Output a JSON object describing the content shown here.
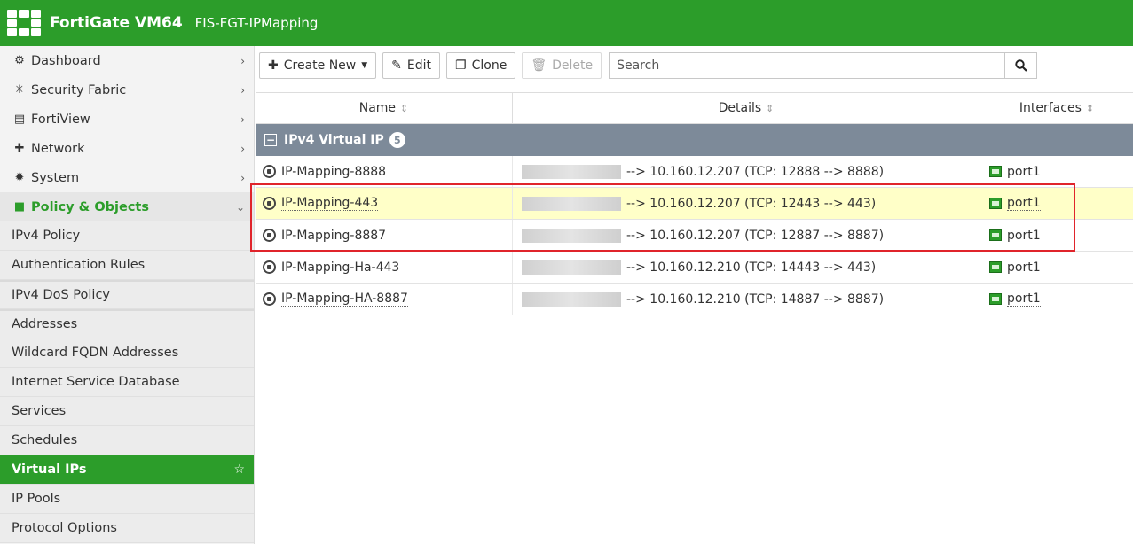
{
  "app": {
    "brand": "FortiGate VM64",
    "hostname": "FIS-FGT-IPMapping",
    "accent_color": "#2c9d2a"
  },
  "sidebar": {
    "items": [
      {
        "label": "Dashboard",
        "icon": "dashboard-icon"
      },
      {
        "label": "Security Fabric",
        "icon": "security-fabric-icon"
      },
      {
        "label": "FortiView",
        "icon": "fortiview-icon"
      },
      {
        "label": "Network",
        "icon": "network-icon"
      },
      {
        "label": "System",
        "icon": "gear-icon"
      },
      {
        "label": "Policy & Objects",
        "icon": "policy-objects-icon",
        "expanded": true
      }
    ],
    "subitems": [
      {
        "label": "IPv4 Policy"
      },
      {
        "label": "Authentication Rules"
      },
      {
        "label": "IPv4 DoS Policy"
      },
      {
        "label": "Addresses"
      },
      {
        "label": "Wildcard FQDN Addresses"
      },
      {
        "label": "Internet Service Database"
      },
      {
        "label": "Services"
      },
      {
        "label": "Schedules"
      },
      {
        "label": "Virtual IPs",
        "active": true
      },
      {
        "label": "IP Pools"
      },
      {
        "label": "Protocol Options"
      }
    ]
  },
  "toolbar": {
    "create_new_label": "Create New",
    "edit_label": "Edit",
    "clone_label": "Clone",
    "delete_label": "Delete",
    "search_placeholder": "Search"
  },
  "table": {
    "columns": [
      "Name",
      "Details",
      "Interfaces"
    ],
    "group": {
      "label": "IPv4 Virtual IP",
      "count": "5"
    },
    "rows": [
      {
        "name": "IP-Mapping-8888",
        "details": "--> 10.160.12.207 (TCP: 12888 --> 8888)",
        "interface": "port1",
        "selected": false
      },
      {
        "name": "IP-Mapping-443",
        "details": "--> 10.160.12.207 (TCP: 12443 --> 443)",
        "interface": "port1",
        "selected": true
      },
      {
        "name": "IP-Mapping-8887",
        "details": "--> 10.160.12.207 (TCP: 12887 --> 8887)",
        "interface": "port1",
        "selected": false
      },
      {
        "name": "IP-Mapping-Ha-443",
        "details": "--> 10.160.12.210 (TCP: 14443 --> 443)",
        "interface": "port1",
        "selected": false
      },
      {
        "name": "IP-Mapping-HA-8887",
        "details": "--> 10.160.12.210 (TCP: 14887 --> 8887)",
        "interface": "port1",
        "selected": false
      }
    ]
  }
}
